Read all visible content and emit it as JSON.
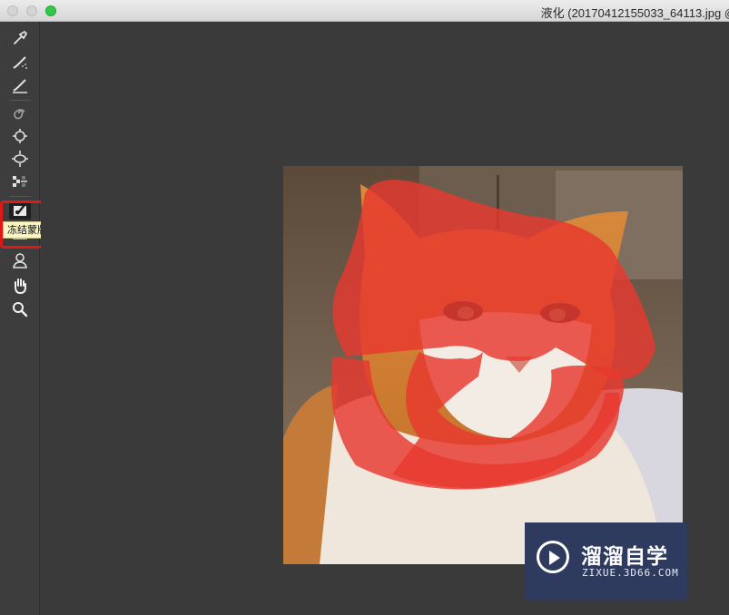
{
  "window": {
    "title": "液化 (20170412155033_64113.jpg @"
  },
  "tools": [
    {
      "name": "forward-warp-icon"
    },
    {
      "name": "reconstruct-icon"
    },
    {
      "name": "smooth-icon"
    },
    {
      "name": "twirl-icon"
    },
    {
      "name": "pucker-icon"
    },
    {
      "name": "bloat-icon"
    },
    {
      "name": "push-left-icon"
    },
    {
      "name": "freeze-mask-icon"
    },
    {
      "name": "thaw-mask-icon"
    },
    {
      "name": "face-tool-icon"
    },
    {
      "name": "hand-icon"
    },
    {
      "name": "zoom-icon"
    }
  ],
  "tooltip": {
    "text": "冻结蒙版工具 (F)"
  },
  "watermark": {
    "brand": "溜溜自学",
    "url": "ZIXUE.3D66.COM"
  },
  "colors": {
    "mask_overlay": "#e8382e",
    "highlight_box": "#e11818",
    "watermark_bg": "#2f3b5e"
  }
}
